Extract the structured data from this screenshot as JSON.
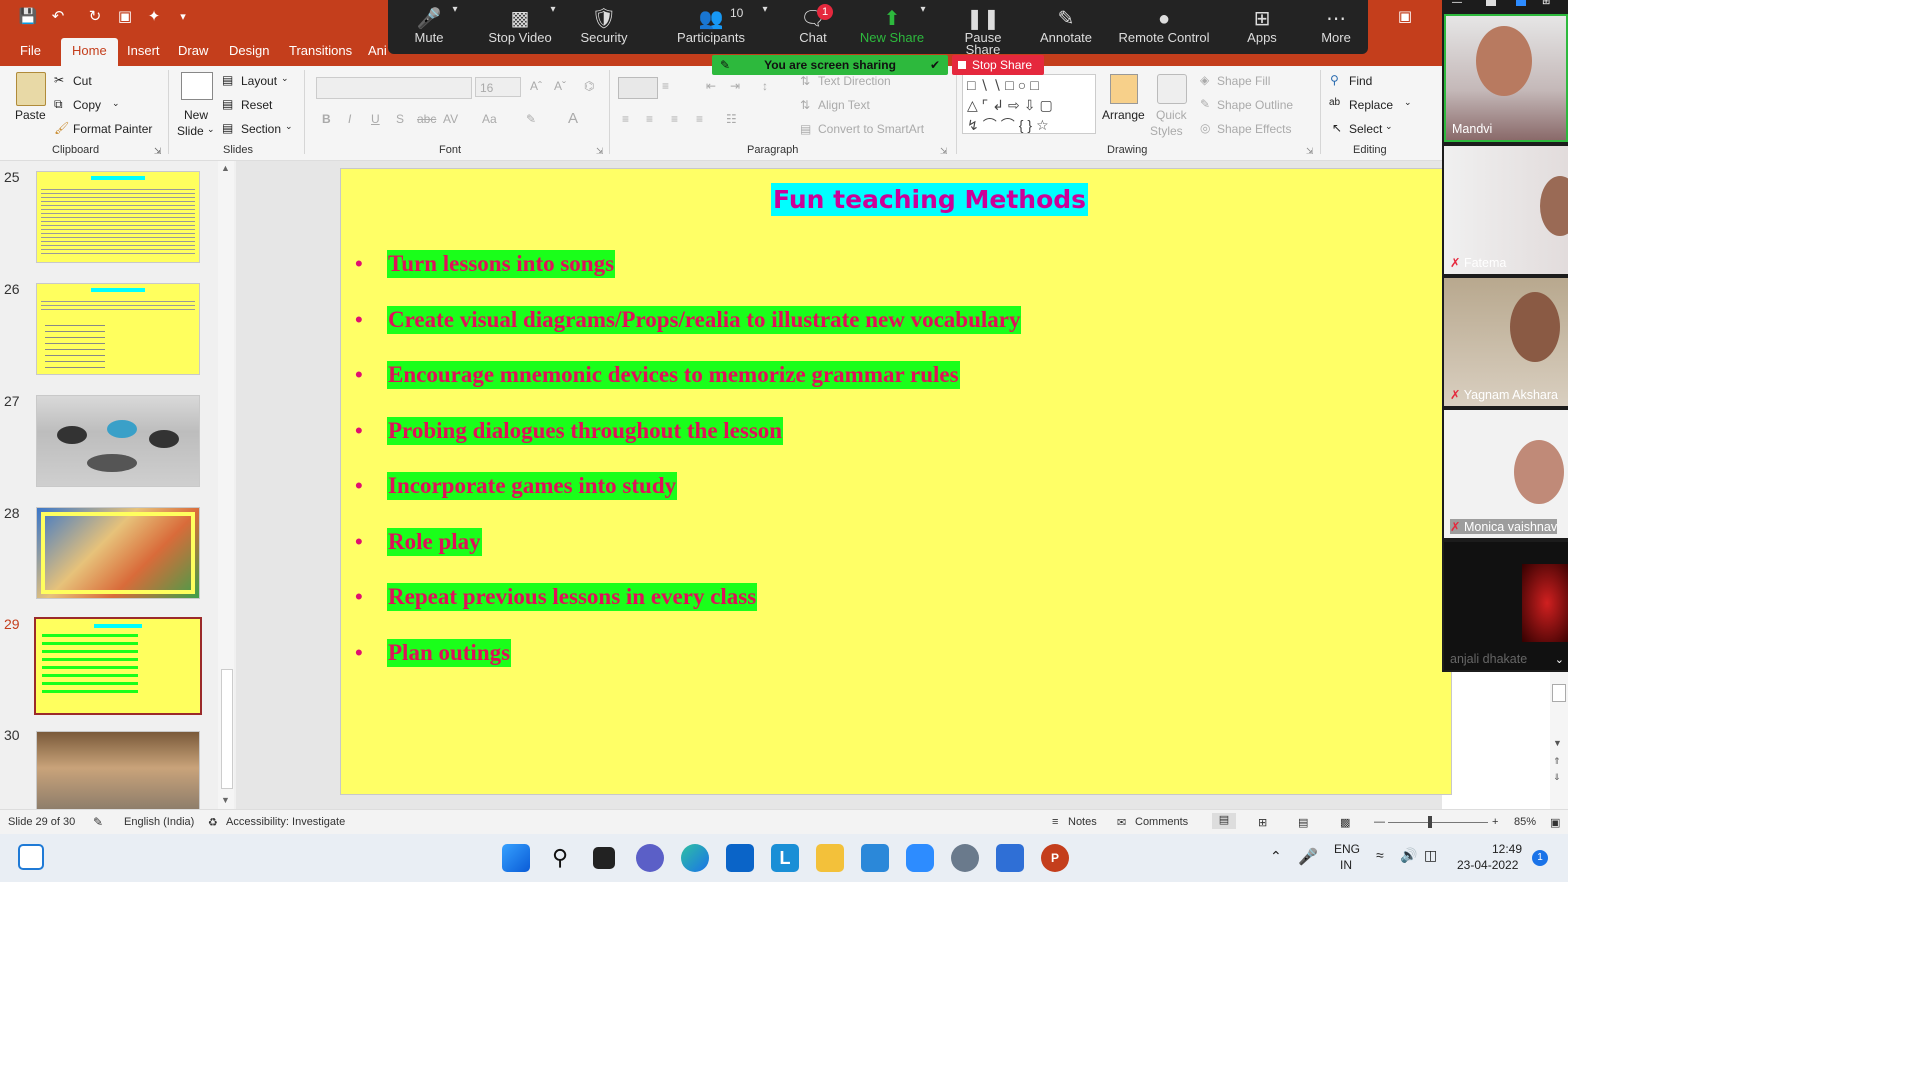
{
  "quick_access": {
    "save_icon": "save-icon",
    "undo_icon": "undo-icon",
    "redo_icon": "redo-icon",
    "present_icon": "present-icon",
    "customize_icon": "customize-icon"
  },
  "tabs": [
    {
      "label": "File",
      "active": false
    },
    {
      "label": "Home",
      "active": true
    },
    {
      "label": "Insert",
      "active": false
    },
    {
      "label": "Draw",
      "active": false
    },
    {
      "label": "Design",
      "active": false
    },
    {
      "label": "Transitions",
      "active": false
    },
    {
      "label": "Ani",
      "active": false
    }
  ],
  "zoom_toolbar": {
    "items": [
      {
        "label": "Mute",
        "icon": "mic-icon"
      },
      {
        "label": "Stop Video",
        "icon": "video-icon"
      },
      {
        "label": "Security",
        "icon": "shield-icon"
      },
      {
        "label": "Participants",
        "icon": "participants-icon",
        "count": "10"
      },
      {
        "label": "Chat",
        "icon": "chat-icon",
        "badge": "1"
      },
      {
        "label": "New Share",
        "icon": "share-icon"
      },
      {
        "label": "Pause Share",
        "icon": "pause-icon"
      },
      {
        "label": "Annotate",
        "icon": "pen-icon"
      },
      {
        "label": "Remote Control",
        "icon": "mouse-icon"
      },
      {
        "label": "Apps",
        "icon": "apps-icon"
      },
      {
        "label": "More",
        "icon": "more-icon"
      }
    ],
    "sharing_text": "You are screen sharing",
    "stop_share": "Stop Share"
  },
  "ribbon": {
    "clipboard": {
      "paste": "Paste",
      "cut": "Cut",
      "copy": "Copy",
      "format_painter": "Format Painter",
      "label": "Clipboard"
    },
    "slides": {
      "new_slide_1": "New",
      "new_slide_2": "Slide",
      "layout": "Layout",
      "reset": "Reset",
      "section": "Section",
      "label": "Slides"
    },
    "font": {
      "size": "16",
      "label": "Font"
    },
    "paragraph": {
      "text_direction": "Text Direction",
      "align_text": "Align Text",
      "convert": "Convert to SmartArt",
      "label": "Paragraph"
    },
    "drawing": {
      "arrange": "Arrange",
      "quick_1": "Quick",
      "quick_2": "Styles",
      "shape_fill": "Shape Fill",
      "shape_outline": "Shape Outline",
      "shape_effects": "Shape Effects",
      "label": "Drawing"
    },
    "editing": {
      "find": "Find",
      "replace": "Replace",
      "select": "Select",
      "label": "Editing"
    }
  },
  "thumbnails": [
    {
      "num": "25",
      "kind": "text"
    },
    {
      "num": "26",
      "kind": "text"
    },
    {
      "num": "27",
      "kind": "classroom"
    },
    {
      "num": "28",
      "kind": "kids"
    },
    {
      "num": "29",
      "kind": "current",
      "selected": true
    },
    {
      "num": "30",
      "kind": "photo"
    }
  ],
  "slide": {
    "title": "Fun teaching Methods",
    "bullets": [
      "Turn lessons into songs",
      "Create visual diagrams/Props/realia to illustrate new vocabulary",
      "Encourage mnemonic devices to memorize grammar rules",
      "Probing dialogues throughout the lesson",
      "Incorporate games into study",
      "Role play",
      "Repeat previous lessons in every class",
      "Plan outings"
    ]
  },
  "participants_video": [
    {
      "name": "Mandvi",
      "muted": false
    },
    {
      "name": "Fatema",
      "muted": true
    },
    {
      "name": "Yagnam Akshara",
      "muted": true
    },
    {
      "name": "Monica vaishnav",
      "muted": true
    },
    {
      "name": "anjali dhakate",
      "muted": false
    }
  ],
  "status": {
    "slide_of": "Slide 29 of 30",
    "language": "English (India)",
    "accessibility": "Accessibility: Investigate",
    "notes": "Notes",
    "comments": "Comments",
    "zoom": "85%"
  },
  "taskbar": {
    "lang1": "ENG",
    "lang2": "IN",
    "time": "12:49",
    "date": "23-04-2022",
    "notif": "1"
  },
  "colors": {
    "ppt_accent": "#c43e1c",
    "slide_bg": "#ffff66",
    "bullet_highlight": "#1aff1a",
    "bullet_text": "#e0105a",
    "title_bg": "#00ffff",
    "title_text": "#cc0099"
  }
}
